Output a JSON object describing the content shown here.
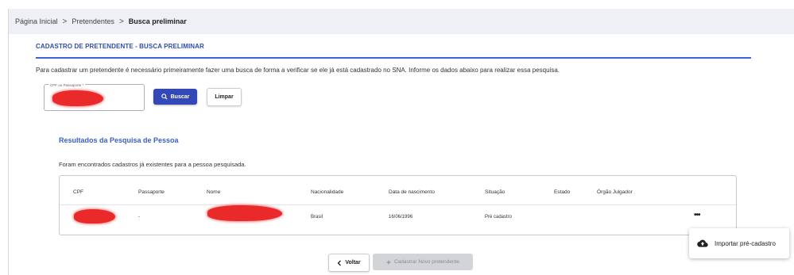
{
  "breadcrumb": {
    "items": [
      "Página Inicial",
      "Pretendentes",
      "Busca preliminar"
    ],
    "separator": ">"
  },
  "section": {
    "title": "CADASTRO DE PRETENDENTE - BUSCA PRELIMINAR",
    "intro": "Para cadastrar um pretendente é necessário primeiramente fazer uma busca de forma a verificar se ele já está cadastrado no SNA. Informe os dados abaixo para realizar essa pesquisa."
  },
  "search": {
    "field_label": "CPF ou Passaporte *",
    "buscar_label": "Buscar",
    "limpar_label": "Limpar"
  },
  "results": {
    "title": "Resultados da Pesquisa de Pessoa",
    "note": "Foram encontrados cadastros já existentes para a pessoa pesquisada.",
    "columns": [
      "CPF",
      "Passaporte",
      "Nome",
      "Nacionalidade",
      "Data de nascimento",
      "Situação",
      "Estado",
      "Órgão Julgador"
    ],
    "rows": [
      {
        "cpf": "",
        "passaporte": "-",
        "nome": "",
        "nacionalidade": "Brasil",
        "data_nascimento": "16/06/1996",
        "situacao": "Pré cadastro",
        "estado": "",
        "orgao": ""
      }
    ],
    "more_label": "•••"
  },
  "menu": {
    "importar_label": "Importar pré-cadastro",
    "icon": "cloud-upload-icon"
  },
  "footer": {
    "voltar_label": "Voltar",
    "cadastrar_label": "Cadastrar Novo pretendente"
  },
  "colors": {
    "accent": "#3248b6",
    "title_blue": "#2f4db0",
    "breadcrumb_bg": "#eef0f6",
    "redaction": "#ea2a2a"
  }
}
